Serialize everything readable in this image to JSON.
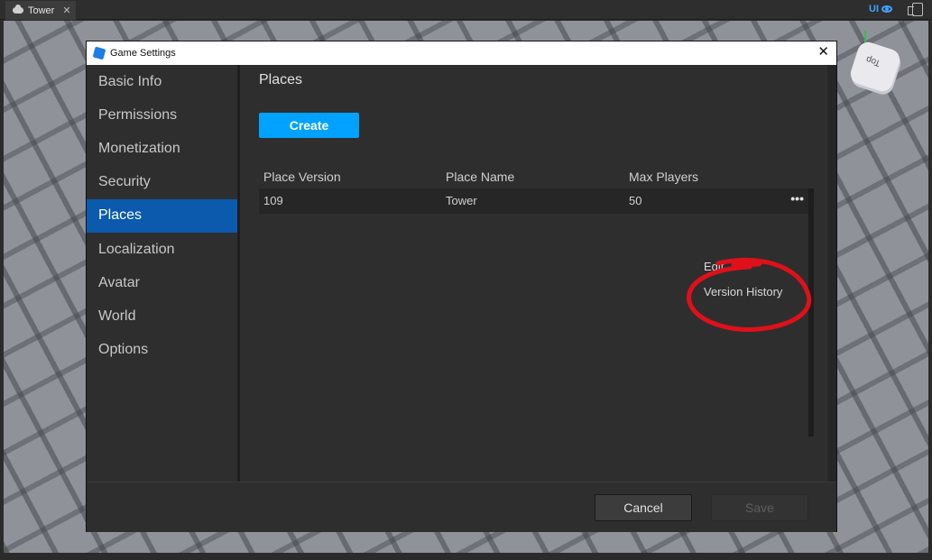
{
  "tabbar": {
    "tab_label": "Tower",
    "tab_close": "✕",
    "ui_toggle_label": "UI"
  },
  "viewcube": {
    "face_label": "Top"
  },
  "dialog": {
    "title": "Game Settings",
    "close": "✕"
  },
  "sidebar": {
    "items": [
      {
        "label": "Basic Info"
      },
      {
        "label": "Permissions"
      },
      {
        "label": "Monetization"
      },
      {
        "label": "Security"
      },
      {
        "label": "Places"
      },
      {
        "label": "Localization"
      },
      {
        "label": "Avatar"
      },
      {
        "label": "World"
      },
      {
        "label": "Options"
      }
    ],
    "active": "Places"
  },
  "main": {
    "title": "Places",
    "create_label": "Create",
    "table": {
      "headers": [
        "Place Version",
        "Place Name",
        "Max Players"
      ],
      "rows": [
        {
          "version": "109",
          "name": "Tower",
          "max_players": "50",
          "more": "•••"
        }
      ]
    },
    "context_menu": {
      "items": [
        "Edit",
        "Version History"
      ]
    }
  },
  "footer": {
    "cancel_label": "Cancel",
    "save_label": "Save"
  },
  "colors": {
    "accent": "#00a2ff",
    "active_nav": "#0b5aae",
    "annotation": "#e0101a"
  }
}
